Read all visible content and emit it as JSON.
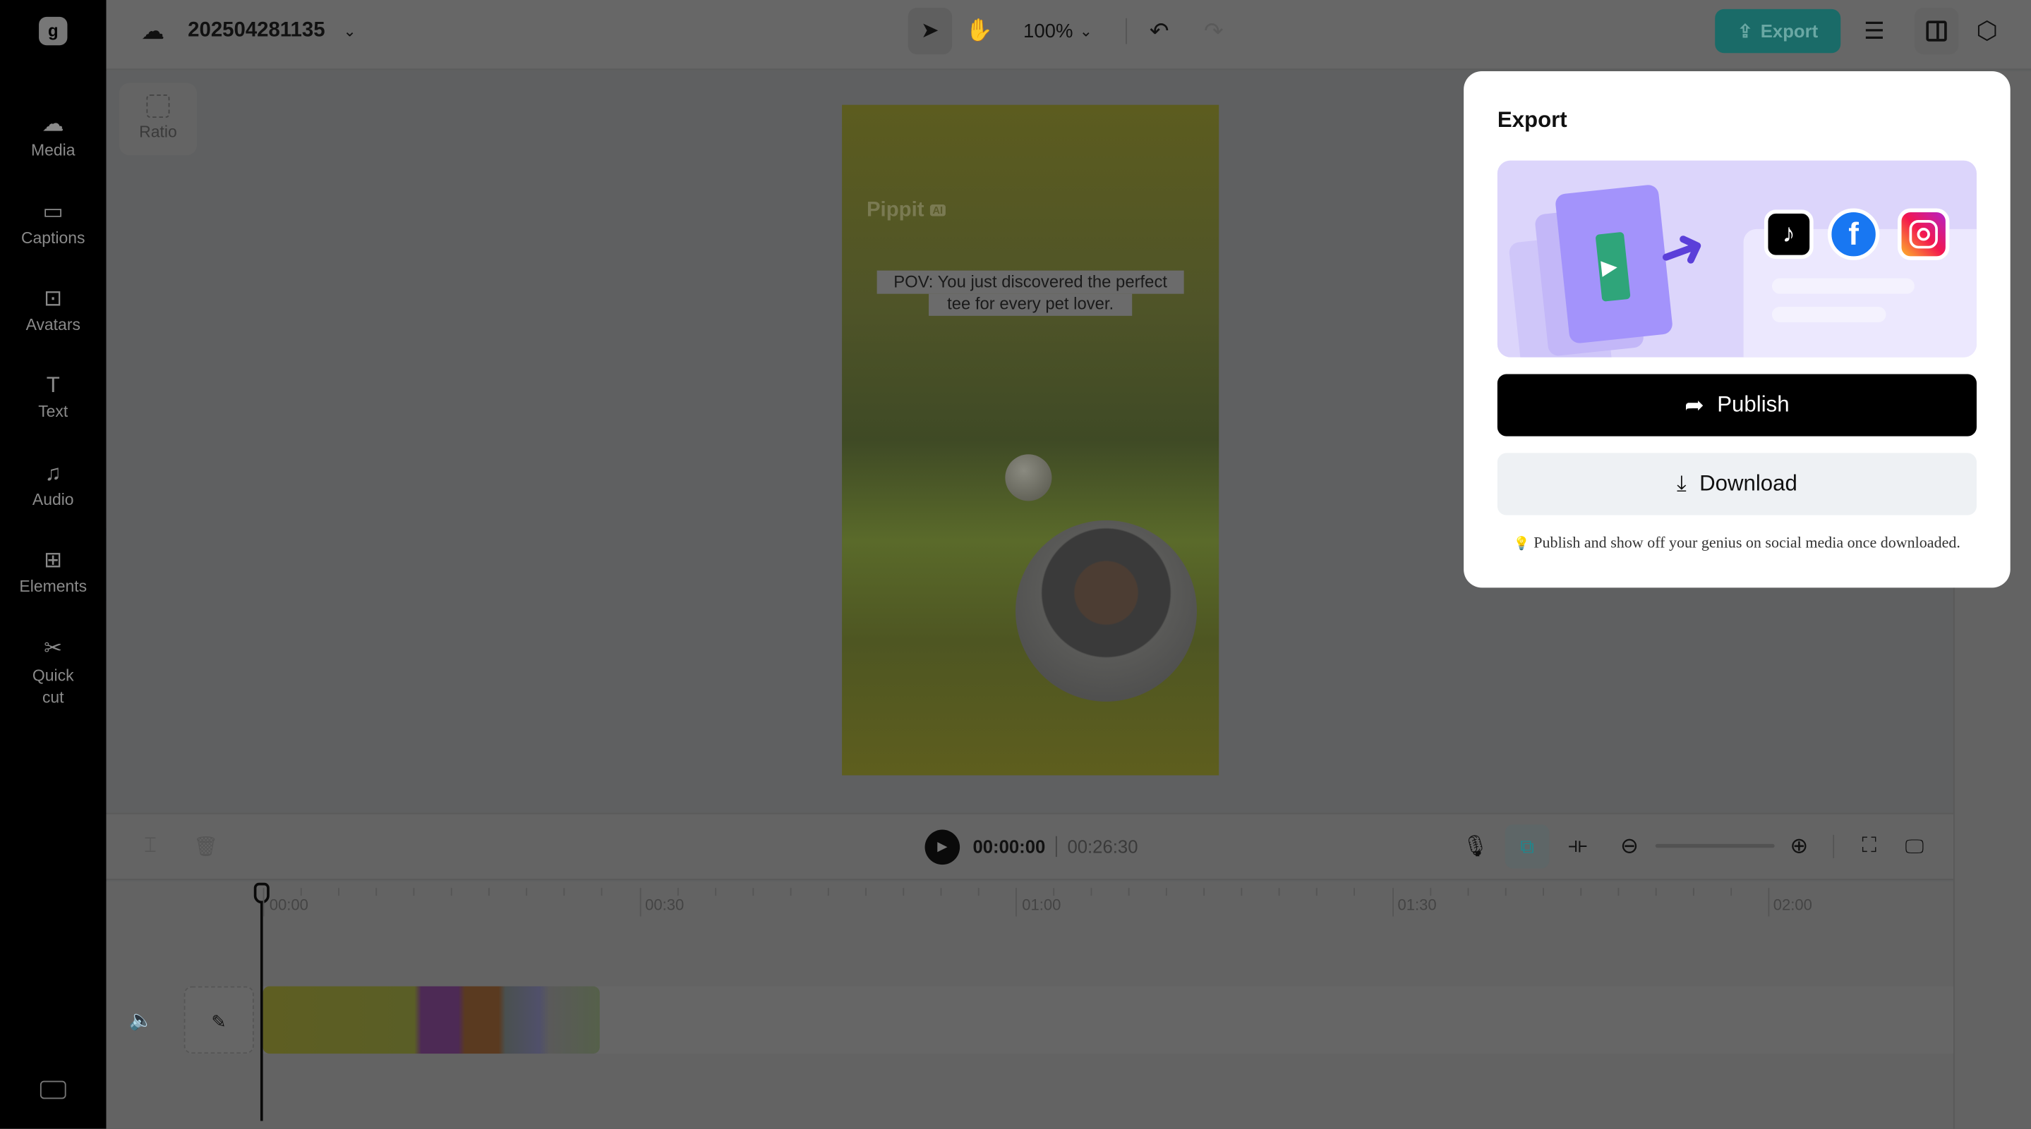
{
  "topbar": {
    "project_name": "202504281135",
    "zoom": "100%",
    "export_label": "Export"
  },
  "sidebar": {
    "items": [
      {
        "label": "Media",
        "icon": "cloud-upload-icon"
      },
      {
        "label": "Captions",
        "icon": "captions-icon"
      },
      {
        "label": "Avatars",
        "icon": "avatar-icon"
      },
      {
        "label": "Text",
        "icon": "text-icon"
      },
      {
        "label": "Audio",
        "icon": "music-note-icon"
      },
      {
        "label": "Elements",
        "icon": "elements-icon"
      },
      {
        "label": "Quick",
        "label2": "cut",
        "icon": "quick-cut-icon"
      }
    ]
  },
  "canvas": {
    "ratio_label": "Ratio",
    "watermark": "Pippit",
    "watermark_badge": "AI",
    "caption_line1": "POV: You just discovered the perfect",
    "caption_line2": "tee for every pet lover."
  },
  "playback": {
    "current": "00:00:00",
    "total": "00:26:30"
  },
  "ruler": [
    "00:00",
    "00:30",
    "01:00",
    "01:30",
    "02:00"
  ],
  "export_popup": {
    "title": "Export",
    "publish_label": "Publish",
    "download_label": "Download",
    "hint": "Publish and show off your genius on social media once downloaded.",
    "hint_icon": "💡",
    "platforms": [
      "tiktok",
      "facebook",
      "instagram"
    ]
  },
  "colors": {
    "export_button": "#1a6b68",
    "illustration_bg": "#dcd5fb",
    "accent_purple": "#5b3fd9"
  }
}
